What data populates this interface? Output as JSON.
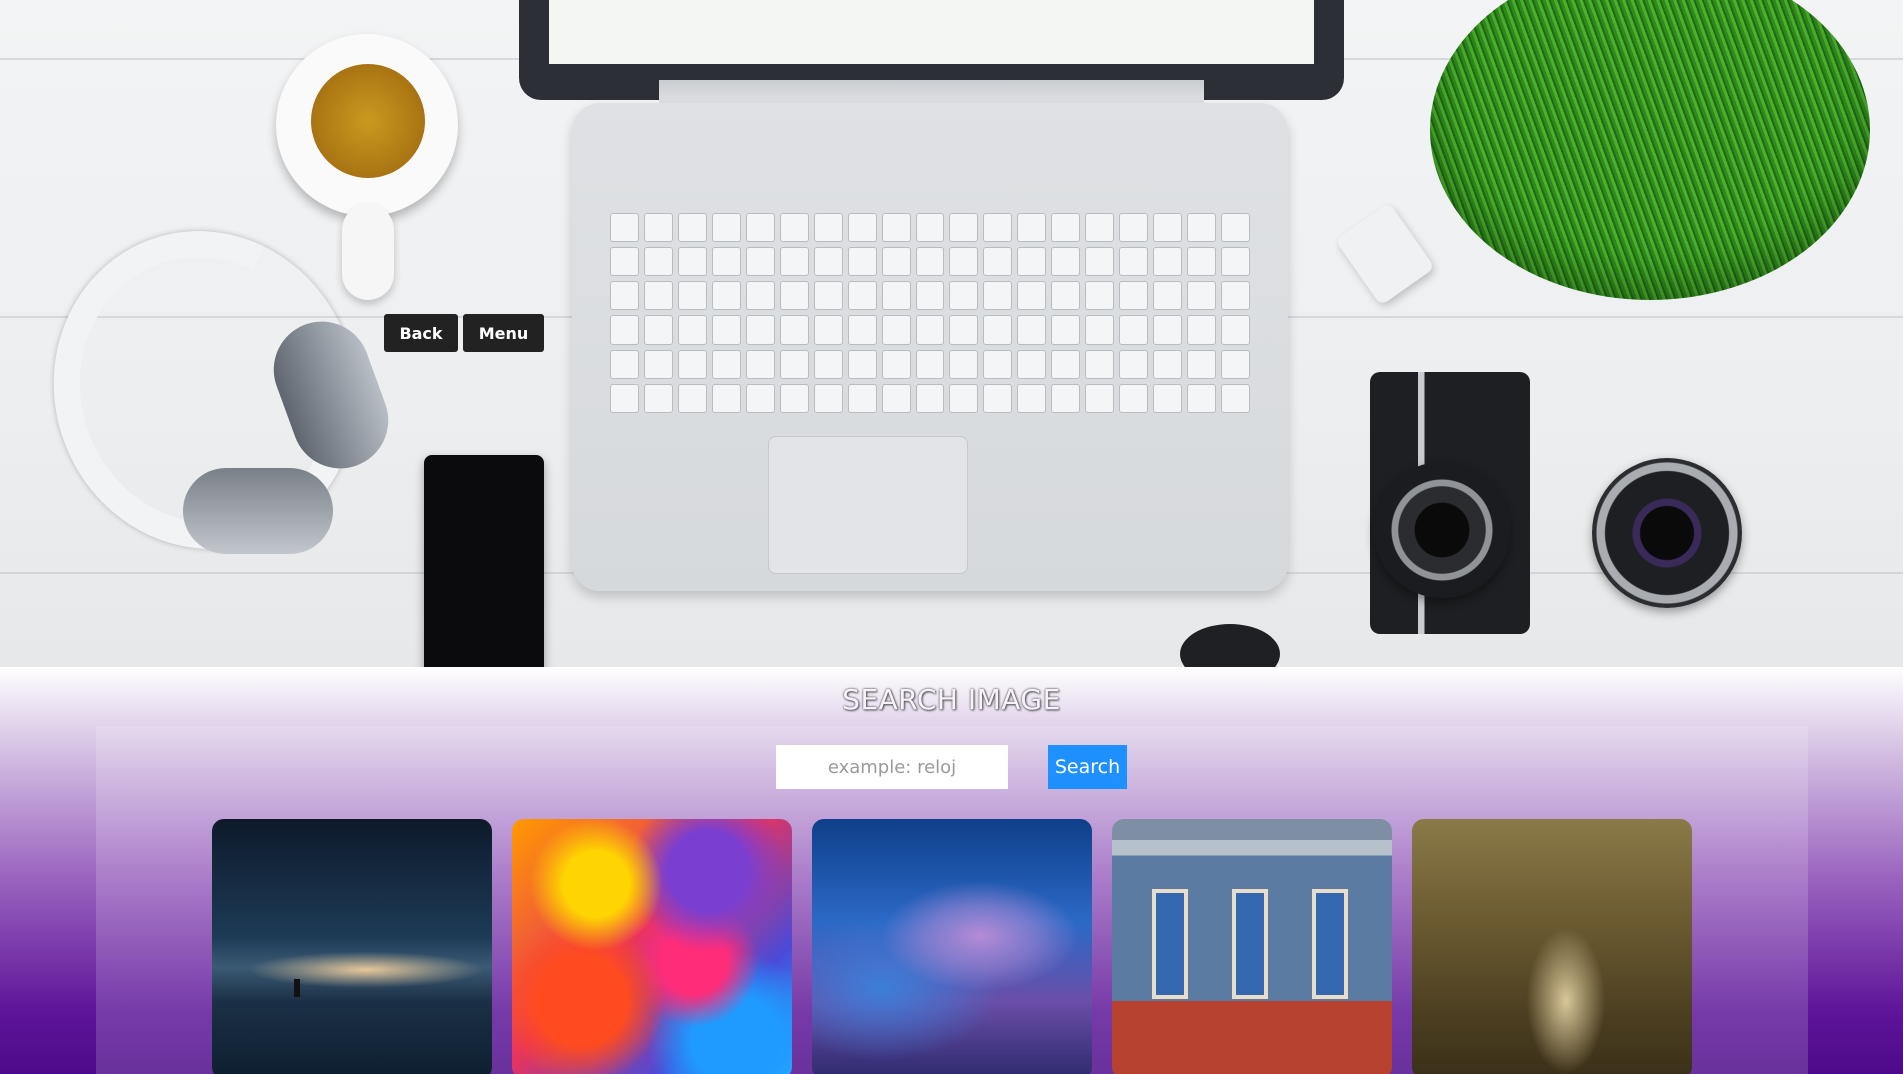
{
  "hero": {
    "back_label": "Back",
    "menu_label": "Menu"
  },
  "search": {
    "title": "SEARCH IMAGE",
    "input_placeholder": "example: reloj",
    "input_value": "",
    "button_label": "Search",
    "accent_color": "#1e90ff"
  },
  "results": [
    {
      "subject": "night sky over water with sailboat"
    },
    {
      "subject": "colorful paint strokes"
    },
    {
      "subject": "storm clouds with lightning"
    },
    {
      "subject": "street with blue doors and red chairs"
    },
    {
      "subject": "dark hedges tree tunnel"
    }
  ]
}
